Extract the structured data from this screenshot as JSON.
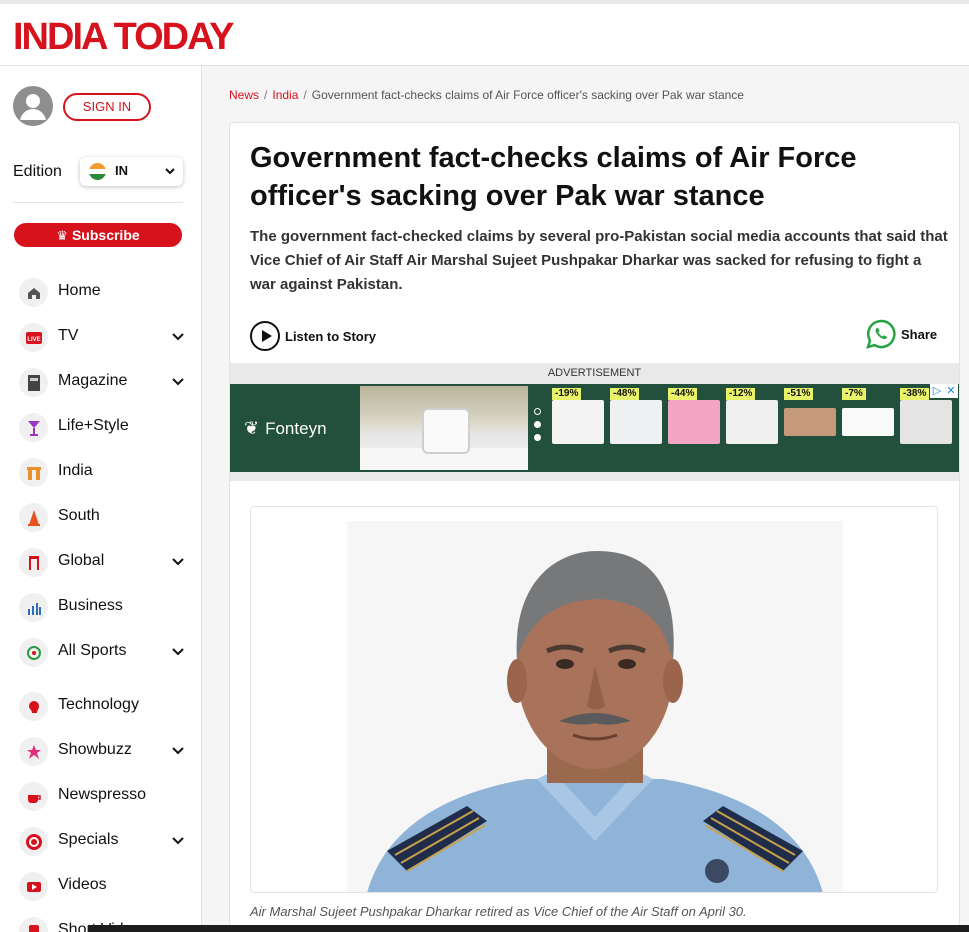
{
  "header": {
    "logo": "INDIA TODAY"
  },
  "sidebar": {
    "signin_label": "SIGN IN",
    "edition_label": "Edition",
    "edition_value": "IN",
    "subscribe_label": "Subscribe",
    "items": [
      {
        "label": "Home",
        "icon": "home-icon",
        "has_submenu": false
      },
      {
        "label": "TV",
        "icon": "live-tv-icon",
        "has_submenu": true
      },
      {
        "label": "Magazine",
        "icon": "magazine-icon",
        "has_submenu": true
      },
      {
        "label": "Life+Style",
        "icon": "cocktail-icon",
        "has_submenu": false
      },
      {
        "label": "India",
        "icon": "india-gate-icon",
        "has_submenu": false
      },
      {
        "label": "South",
        "icon": "temple-icon",
        "has_submenu": false
      },
      {
        "label": "Global",
        "icon": "globe-icon",
        "has_submenu": true
      },
      {
        "label": "Business",
        "icon": "bar-chart-icon",
        "has_submenu": false
      },
      {
        "label": "All Sports",
        "icon": "sports-icon",
        "has_submenu": true
      },
      {
        "label": "Technology",
        "icon": "brain-chip-icon",
        "has_submenu": false
      },
      {
        "label": "Showbuzz",
        "icon": "star-icon",
        "has_submenu": true
      },
      {
        "label": "Newspresso",
        "icon": "coffee-cup-icon",
        "has_submenu": false
      },
      {
        "label": "Specials",
        "icon": "specials-badge-icon",
        "has_submenu": true
      },
      {
        "label": "Videos",
        "icon": "video-play-icon",
        "has_submenu": false
      },
      {
        "label": "Short Videos",
        "icon": "short-video-icon",
        "has_submenu": false
      }
    ]
  },
  "breadcrumb": [
    "News",
    "India",
    "Government fact-checks claims of Air Force officer's sacking over Pak war stance"
  ],
  "article": {
    "headline": "Government fact-checks claims of Air Force officer's sacking over Pak war stance",
    "summary": "The government fact-checked claims by several pro-Pakistan social media accounts that said that Vice Chief of Air Staff Air Marshal Sujeet Pushpakar Dharkar was sacked for refusing to fight a war against Pakistan.",
    "listen_label": "Listen to Story",
    "share_label": "Share",
    "caption": "Air Marshal Sujeet Pushpakar Dharkar retired as Vice Chief of the Air Staff on April 30."
  },
  "advertisement": {
    "label": "ADVERTISEMENT",
    "brand": "Fonteyn",
    "discounts": [
      "-19%",
      "-48%",
      "-44%",
      "-12%",
      "-51%",
      "-7%",
      "-38%"
    ]
  },
  "colors": {
    "brand_red": "#d7121d",
    "ad_green": "#23503c",
    "whatsapp_green": "#25d366"
  }
}
